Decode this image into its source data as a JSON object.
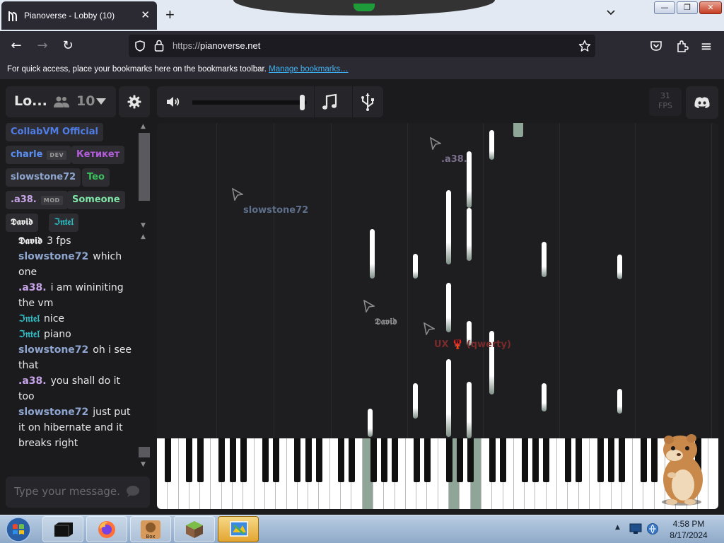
{
  "browser": {
    "tab_title": "Pianoverse - Lobby (10)",
    "tab_close": "✕",
    "new_tab": "+",
    "url_proto": "https://",
    "url_host": "pianoverse.net",
    "bookmarks_text": "For quick access, place your bookmarks here on the bookmarks toolbar.",
    "bookmarks_link": "Manage bookmarks…",
    "win_min": "—",
    "win_max": "❐",
    "win_close": "✕",
    "nav_back": "←",
    "nav_forward": "→",
    "nav_reload": "↻",
    "menu": "≡"
  },
  "lobby": {
    "name": "Lo...",
    "user_count": "10"
  },
  "users": [
    {
      "name": "CollabVM Official",
      "color": "#4f7de8",
      "tag": ""
    },
    {
      "name": "charle",
      "color": "#5a8ff0",
      "tag": "DEV"
    },
    {
      "name": "Кетикет",
      "color": "#b25cd9",
      "tag": ""
    },
    {
      "name": "slowstone72",
      "color": "#8ea6cf",
      "tag": ""
    },
    {
      "name": "Teo",
      "color": "#3bbf5e",
      "tag": ""
    },
    {
      "name": ".a38.",
      "color": "#c6a4e8",
      "tag": "MOD"
    },
    {
      "name": "Someone",
      "color": "#7fe6a8",
      "tag": ""
    },
    {
      "name": "𝕯𝖆𝖛𝖎𝖉",
      "color": "#e8e8e8",
      "tag": ""
    },
    {
      "name": "ℑ𝔫𝔱𝔢𝔩",
      "color": "#2fc1c8",
      "tag": ""
    }
  ],
  "chat": [
    {
      "user": "𝕯𝖆𝖛𝖎𝖉",
      "color": "#e8e8e8",
      "text": "3 fps"
    },
    {
      "user": "slowstone72",
      "color": "#8ea6cf",
      "text": "which one"
    },
    {
      "user": ".a38.",
      "color": "#c6a4e8",
      "text": "i am wininiting the vm"
    },
    {
      "user": "ℑ𝔫𝔱𝔢𝔩",
      "color": "#2fc1c8",
      "text": "nice"
    },
    {
      "user": "ℑ𝔫𝔱𝔢𝔩",
      "color": "#2fc1c8",
      "text": "piano"
    },
    {
      "user": "slowstone72",
      "color": "#8ea6cf",
      "text": "oh i see that"
    },
    {
      "user": ".a38.",
      "color": "#c6a4e8",
      "text": "you shall do it too"
    },
    {
      "user": "slowstone72",
      "color": "#8ea6cf",
      "text": "just put it on hibernate and it breaks right"
    }
  ],
  "chat_input": {
    "placeholder": "Type your message..."
  },
  "volume": {
    "level": 0.96
  },
  "fps": {
    "value": "31",
    "unit": "FPS"
  },
  "cursors": [
    {
      "label": ".a38.",
      "color": "#7a6f8a"
    },
    {
      "label": "slowstone72",
      "color": "#5d6f8a"
    },
    {
      "label": "𝕯𝖆𝖛𝖎𝖉",
      "color": "#8a8a8a"
    },
    {
      "label": "UX 🦞 (qwerty)",
      "color": "#7a2a2a"
    }
  ],
  "taskbar": {
    "time": "4:58 PM",
    "date": "8/17/2024"
  }
}
